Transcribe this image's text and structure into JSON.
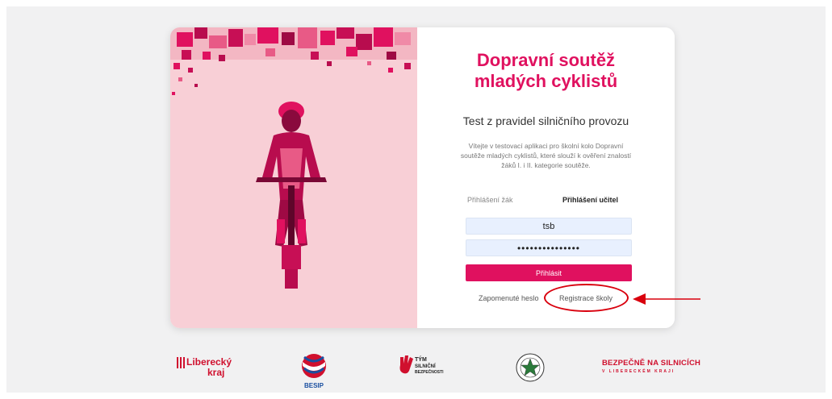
{
  "title_line1": "Dopravní soutěž",
  "title_line2": "mladých cyklistů",
  "subtitle": "Test z pravidel silničního provozu",
  "intro": "Vítejte v testovací aplikaci pro školní kolo Dopravní soutěže mladých cyklistů, které slouží k ověření znalostí žáků I. i II. kategorie soutěže.",
  "tabs": {
    "student": "Přihlášení žák",
    "teacher": "Přihlášení učitel"
  },
  "form": {
    "username_value": "tsb",
    "password_value": "•••••••••••••••",
    "login_label": "Přihlásit"
  },
  "links": {
    "forgot_password": "Zapomenuté heslo",
    "register_school": "Registrace školy"
  },
  "logos": {
    "liberecky_line1": "Liberecký",
    "liberecky_line2": "kraj",
    "besip": "BESIP",
    "tym_line1": "TÝM",
    "tym_line2": "SILNIČNÍ",
    "tym_line3": "BEZPEČNOSTI",
    "bezpecne_line1": "BEZPEČNĚ NA SILNICÍCH",
    "bezpecne_line2": "V LIBERECKÉM KRAJI"
  },
  "colors": {
    "accent": "#e0115f",
    "highlight": "#d9000d",
    "panel_pink": "#f8cfd6"
  },
  "icons": {
    "cyclist": "cyclist-illustration",
    "arrow": "arrow-left-icon",
    "police_star": "police-star-icon"
  }
}
